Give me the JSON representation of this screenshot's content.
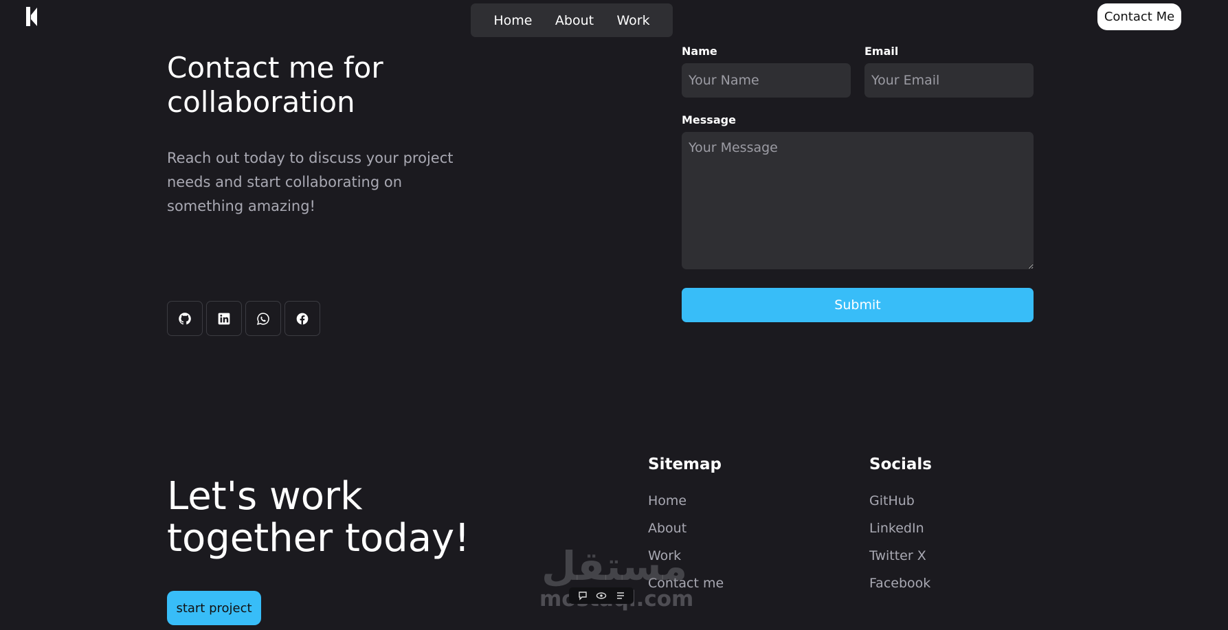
{
  "header": {
    "nav": [
      "Home",
      "About",
      "Work"
    ],
    "contact_button": "Contact Me"
  },
  "contact": {
    "title": "Contact me for collaboration",
    "description": "Reach out today to discuss your project needs and start collaborating on something amazing!",
    "socials": [
      "github-icon",
      "linkedin-icon",
      "whatsapp-icon",
      "facebook-icon"
    ]
  },
  "form": {
    "name_label": "Name",
    "name_placeholder": "Your Name",
    "email_label": "Email",
    "email_placeholder": "Your Email",
    "message_label": "Message",
    "message_placeholder": "Your Message",
    "submit_label": "Submit"
  },
  "footer": {
    "title": "Let's work together today!",
    "start_button": "start project",
    "sitemap_heading": "Sitemap",
    "sitemap": [
      "Home",
      "About",
      "Work",
      "Contact me"
    ],
    "socials_heading": "Socials",
    "socials": [
      "GitHub",
      "LinkedIn",
      "Twitter X",
      "Facebook"
    ]
  },
  "watermark": {
    "arabic": "مستقل",
    "latin": "mostaql.com"
  },
  "colors": {
    "background": "#1b1a1f",
    "surface": "#2f2f33",
    "accent": "#38bdf8",
    "muted_text": "#a9a9b3"
  }
}
